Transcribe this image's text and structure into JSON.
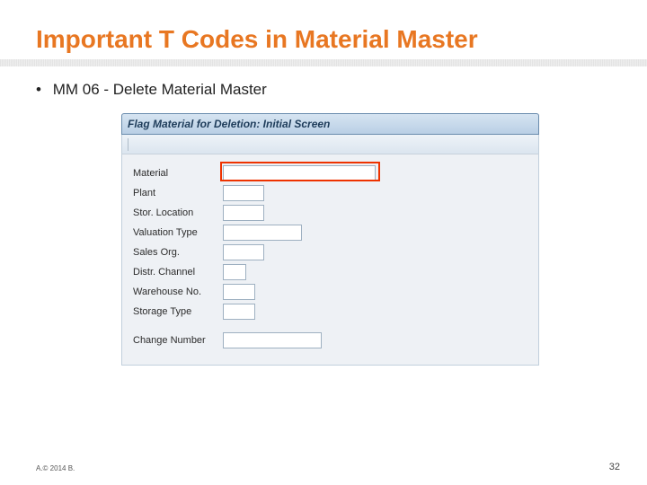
{
  "slide": {
    "title": "Important T Codes in Material Master",
    "bullet_prefix": "•",
    "tcode": "MM 06",
    "sep": " - ",
    "tcode_desc": "Delete Material Master",
    "footer_left": "A.© 2014 B.",
    "page_number": "32"
  },
  "sap": {
    "window_title": "Flag Material for Deletion: Initial Screen",
    "fields": {
      "material": {
        "label": "Material",
        "value": ""
      },
      "plant": {
        "label": "Plant",
        "value": ""
      },
      "sloc": {
        "label": "Stor. Location",
        "value": ""
      },
      "vtype": {
        "label": "Valuation Type",
        "value": ""
      },
      "sorg": {
        "label": "Sales Org.",
        "value": ""
      },
      "dchan": {
        "label": "Distr. Channel",
        "value": ""
      },
      "whs": {
        "label": "Warehouse No.",
        "value": ""
      },
      "stype": {
        "label": "Storage Type",
        "value": ""
      },
      "chgno": {
        "label": "Change Number",
        "value": ""
      }
    }
  }
}
